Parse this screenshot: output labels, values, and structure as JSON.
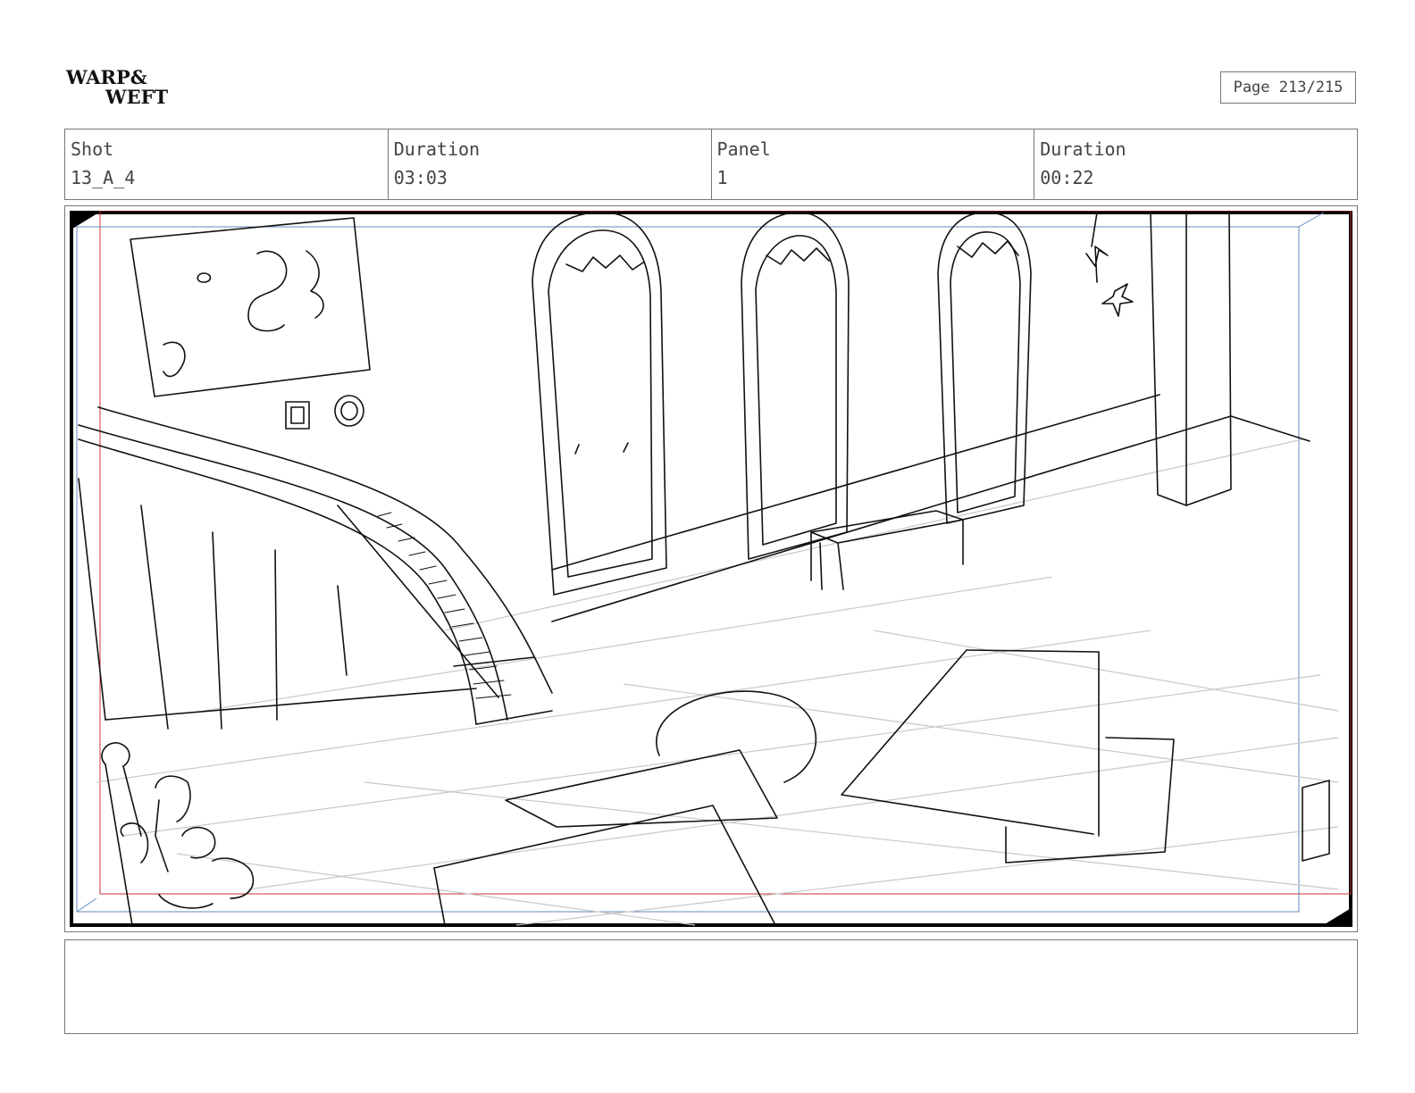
{
  "logo": {
    "line1": "WARP&",
    "line2": "WEFT"
  },
  "page": {
    "label": "Page 213/215"
  },
  "info": [
    {
      "label": "Shot",
      "value": "13_A_4"
    },
    {
      "label": "Duration",
      "value": "03:03"
    },
    {
      "label": "Panel",
      "value": "1"
    },
    {
      "label": "Duration",
      "value": "00:22"
    }
  ],
  "panel": {
    "subject": "pencil sketch storyboard panel",
    "colors": {
      "frame": "#000000",
      "safe_area": "#cc3333",
      "guide": "#6688bb",
      "sketch": "#111111",
      "floor_grid": "#c8c8c8"
    }
  },
  "notes": {
    "text": ""
  }
}
